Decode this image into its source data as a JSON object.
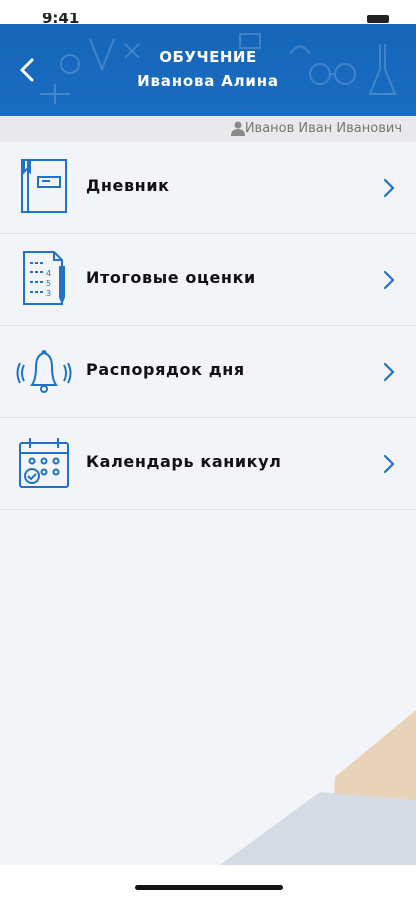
{
  "status": {
    "time": "9:41"
  },
  "header": {
    "title": "ОБУЧЕНИЕ",
    "subtitle": "Иванова Алина",
    "color": "#1566b8"
  },
  "user": {
    "name": "Иванов Иван Иванович"
  },
  "menu": [
    {
      "label": "Дневник",
      "icon": "diary-book-icon"
    },
    {
      "label": "Итоговые оценки",
      "icon": "grades-list-icon"
    },
    {
      "label": "Распорядок дня",
      "icon": "bell-icon"
    },
    {
      "label": "Календарь каникул",
      "icon": "calendar-icon"
    }
  ],
  "colors": {
    "accent": "#1e73c8",
    "background": "#f2f4f8"
  }
}
